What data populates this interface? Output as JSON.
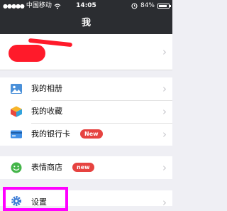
{
  "status_bar": {
    "carrier": "中国移动",
    "time": "14:05",
    "battery_text": "84%",
    "battery_level": 0.84
  },
  "nav": {
    "title": "我"
  },
  "menu": {
    "items": [
      {
        "label": "我的相册",
        "icon": "photo-album-icon"
      },
      {
        "label": "我的收藏",
        "icon": "favorites-cube-icon"
      },
      {
        "label": "我的银行卡",
        "icon": "bank-card-icon",
        "badge": "New"
      },
      {
        "label": "表情商店",
        "icon": "sticker-smiley-icon",
        "badge": "new"
      },
      {
        "label": "设置",
        "icon": "gear-icon"
      }
    ]
  },
  "colors": {
    "header_bg": "#2b2d31",
    "badge_red": "#e64340",
    "highlight_magenta": "#ff00ff",
    "background": "#efeff4"
  }
}
